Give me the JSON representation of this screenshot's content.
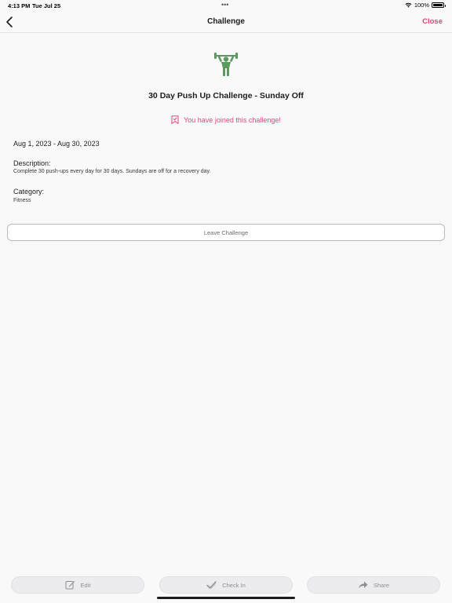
{
  "status_bar": {
    "time": "4:13 PM",
    "date": "Tue Jul 25",
    "dots": "•••",
    "battery_text": "100%"
  },
  "nav": {
    "title": "Challenge",
    "close_label": "Close"
  },
  "challenge": {
    "icon": "weightlifter-icon",
    "title": "30 Day Push Up Challenge - Sunday Off",
    "joined_text": "You have joined this challenge!",
    "dates": "Aug 1, 2023 - Aug 30, 2023",
    "description_label": "Description:",
    "description": "Complete 30 push-ups every day for 30 days.  Sundays are off for a recovery day.",
    "category_label": "Category:",
    "category": "Fitness",
    "leave_label": "Leave Challenge"
  },
  "toolbar": {
    "edit_label": "Edit",
    "checkin_label": "Check In",
    "share_label": "Share"
  },
  "colors": {
    "accent": "#e0457b",
    "icon_green": "#5a9a5e",
    "background": "#f9f9f9"
  }
}
